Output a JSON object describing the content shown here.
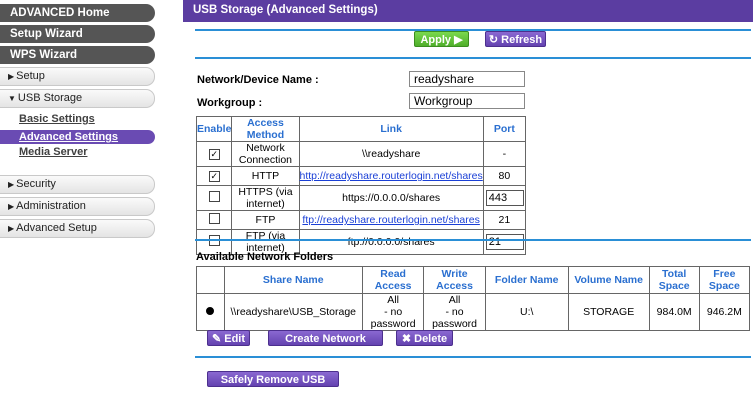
{
  "sidebar": {
    "advanced_home": "ADVANCED Home",
    "setup_wizard": "Setup Wizard",
    "wps_wizard": "WPS Wizard",
    "setup": "Setup",
    "usb_storage": "USB Storage",
    "basic_settings": "Basic Settings",
    "advanced_settings": "Advanced Settings",
    "media_server": "Media Server",
    "security": "Security",
    "administration": "Administration",
    "advanced_setup": "Advanced Setup"
  },
  "header": {
    "title": "USB Storage (Advanced Settings)"
  },
  "toolbar": {
    "apply": "Apply ▶",
    "refresh": "↻ Refresh"
  },
  "form": {
    "device_name_label": "Network/Device Name :",
    "device_name_value": "readyshare",
    "workgroup_label": "Workgroup :",
    "workgroup_value": "Workgroup"
  },
  "access_table": {
    "headers": [
      "Enable",
      "Access Method",
      "Link",
      "Port"
    ],
    "rows": [
      {
        "enabled": "✓",
        "method": "Network Connection",
        "link": "\\\\readyshare",
        "port": "-"
      },
      {
        "enabled": "✓",
        "method": "HTTP",
        "link": "http://readyshare.routerlogin.net/shares",
        "port": "80"
      },
      {
        "enabled": "",
        "method": "HTTPS (via internet)",
        "link": "https://0.0.0.0/shares",
        "port": "443"
      },
      {
        "enabled": "",
        "method": "FTP",
        "link": "ftp://readyshare.routerlogin.net/shares",
        "port": "21"
      },
      {
        "enabled": "",
        "method": "FTP (via internet)",
        "link": "ftp://0.0.0.0/shares",
        "port": "21"
      }
    ]
  },
  "folders": {
    "section_title": "Available Network Folders",
    "headers": [
      "Share Name",
      "Read Access",
      "Write Access",
      "Folder Name",
      "Volume Name",
      "Total Space",
      "Free Space"
    ],
    "row": {
      "share_name": "\\\\readyshare\\USB_Storage",
      "read_access_1": "All",
      "read_access_2": "- no password",
      "write_access_1": "All",
      "write_access_2": "- no password",
      "folder_name": "U:\\",
      "volume_name": "STORAGE",
      "total_space": "984.0M",
      "free_space": "946.2M"
    }
  },
  "folder_buttons": {
    "edit": "Edit",
    "create": "Create Network Folder",
    "delete": "Delete"
  },
  "footer": {
    "safely_remove": "Safely Remove USB Device"
  }
}
